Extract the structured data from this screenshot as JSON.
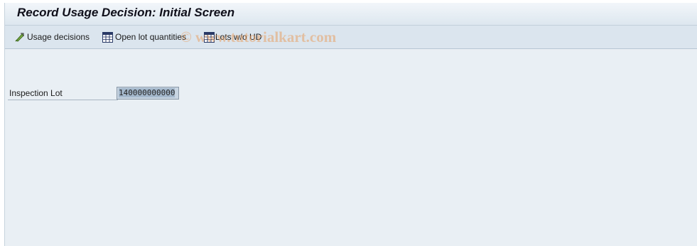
{
  "window": {
    "title": "Record Usage Decision: Initial Screen"
  },
  "toolbar": {
    "items": [
      {
        "label": "Usage decisions",
        "icon": "usage-decision-icon"
      },
      {
        "label": "Open lot quantities",
        "icon": "table-grid-icon"
      },
      {
        "label": "Lots w/o UD",
        "icon": "table-grid-icon"
      }
    ]
  },
  "watermark": {
    "text": "© www.tutorialkart.com"
  },
  "form": {
    "inspection_lot": {
      "label": "Inspection Lot",
      "value": "140000000000"
    }
  },
  "colors": {
    "background": "#e9eff4",
    "title_bar": "#dde7ef",
    "toolbar": "#dbe5ee",
    "input_selected": "#a4b8cc"
  }
}
